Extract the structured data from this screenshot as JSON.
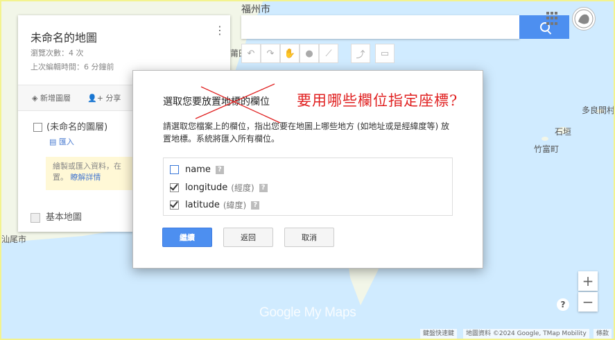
{
  "map": {
    "labels": {
      "fuzhou": "福州市",
      "putian": "莆田",
      "shantou": "汕尾市",
      "duoliang": "多良間村",
      "ishigaki": "石垣",
      "taketomi": "竹富町"
    },
    "watermark": "Google My Maps",
    "help": "?",
    "zoom_in": "+",
    "zoom_out": "−",
    "footer": {
      "shortcuts": "鍵盤快速鍵",
      "attribution": "地圖資料 ©2024 Google, TMap Mobility",
      "terms": "條款"
    }
  },
  "panel": {
    "title": "未命名的地圖",
    "views": "瀏覽次數：4 次",
    "last_edit": "上次編輯時間：6 分鐘前",
    "add_layer": "新增圖層",
    "share": "分享",
    "layer_name": "(未命名的圖層)",
    "import": "匯入",
    "tip_line1": "繪製或匯入資料，在",
    "tip_line2": "置。",
    "tip_link": "瞭解詳情",
    "basemap": "基本地圖"
  },
  "dialog": {
    "title": "選取您要放置地標的欄位",
    "annotation": "要用哪些欄位指定座標?",
    "description": "請選取您檔案上的欄位，指出您要在地圖上哪些地方 (如地址或是經緯度等) 放置地標。系統將匯入所有欄位。",
    "fields": [
      {
        "name": "name",
        "hint": "",
        "checked": false
      },
      {
        "name": "longitude",
        "hint": "(經度)",
        "checked": true
      },
      {
        "name": "latitude",
        "hint": "(緯度)",
        "checked": true
      }
    ],
    "continue": "繼續",
    "back": "返回",
    "cancel": "取消"
  },
  "colors": {
    "accent": "#4d8ff0",
    "annotation": "#e02020",
    "water": "#aadaff"
  }
}
